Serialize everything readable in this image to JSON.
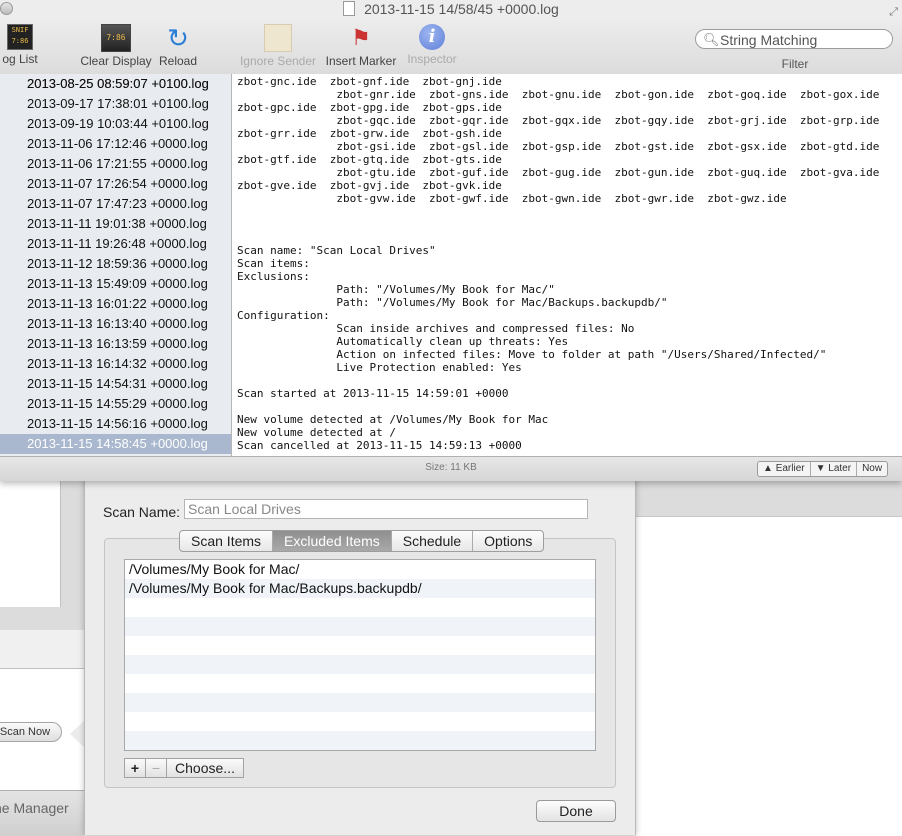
{
  "window": {
    "title": "2013-11-15 14/58/45 +0000.log"
  },
  "toolbar": {
    "log_list_label": "og List",
    "log_list_icon_text": "SNIF 7:86",
    "clear_display_label": "Clear Display",
    "clear_display_icon_text": "7:86",
    "reload_label": "Reload",
    "ignore_sender_label": "Ignore Sender",
    "insert_marker_label": "Insert Marker",
    "inspector_label": "Inspector",
    "filter_placeholder": "String Matching",
    "filter_label": "Filter"
  },
  "log_list": {
    "partial_top": "",
    "items": [
      "2013-08-25 08:59:07 +0100.log",
      "2013-09-17 17:38:01 +0100.log",
      "2013-09-19 10:03:44 +0100.log",
      "2013-11-06 17:12:46 +0000.log",
      "2013-11-06 17:21:55 +0000.log",
      "2013-11-07 17:26:54 +0000.log",
      "2013-11-07 17:47:23 +0000.log",
      "2013-11-11 19:01:38 +0000.log",
      "2013-11-11 19:26:48 +0000.log",
      "2013-11-12 18:59:36 +0000.log",
      "2013-11-13 15:49:09 +0000.log",
      "2013-11-13 16:01:22 +0000.log",
      "2013-11-13 16:13:40 +0000.log",
      "2013-11-13 16:13:59 +0000.log",
      "2013-11-13 16:14:32 +0000.log",
      "2013-11-15 14:54:31 +0000.log",
      "2013-11-15 14:55:29 +0000.log",
      "2013-11-15 14:56:16 +0000.log",
      "2013-11-15 14:58:45 +0000.log"
    ],
    "selected_index": 18
  },
  "log_text": [
    "zbot-gnc.ide  zbot-gnf.ide  zbot-gnj.ide",
    "               zbot-gnr.ide  zbot-gns.ide  zbot-gnu.ide  zbot-gon.ide  zbot-goq.ide  zbot-gox.ide",
    "zbot-gpc.ide  zbot-gpg.ide  zbot-gps.ide",
    "               zbot-gqc.ide  zbot-gqr.ide  zbot-gqx.ide  zbot-gqy.ide  zbot-grj.ide  zbot-grp.ide",
    "zbot-grr.ide  zbot-grw.ide  zbot-gsh.ide",
    "               zbot-gsi.ide  zbot-gsl.ide  zbot-gsp.ide  zbot-gst.ide  zbot-gsx.ide  zbot-gtd.ide",
    "zbot-gtf.ide  zbot-gtq.ide  zbot-gts.ide",
    "               zbot-gtu.ide  zbot-guf.ide  zbot-gug.ide  zbot-gun.ide  zbot-guq.ide  zbot-gva.ide",
    "zbot-gve.ide  zbot-gvj.ide  zbot-gvk.ide",
    "               zbot-gvw.ide  zbot-gwf.ide  zbot-gwn.ide  zbot-gwr.ide  zbot-gwz.ide",
    "",
    "",
    "",
    "Scan name: \"Scan Local Drives\"",
    "Scan items:",
    "Exclusions:",
    "               Path: \"/Volumes/My Book for Mac/\"",
    "               Path: \"/Volumes/My Book for Mac/Backups.backupdb/\"",
    "Configuration:",
    "               Scan inside archives and compressed files: No",
    "               Automatically clean up threats: Yes",
    "               Action on infected files: Move to folder at path \"/Users/Shared/Infected/\"",
    "               Live Protection enabled: Yes",
    "",
    "Scan started at 2013-11-15 14:59:01 +0000",
    "",
    "New volume detected at /Volumes/My Book for Mac",
    "New volume detected at /",
    "Scan cancelled at 2013-11-15 14:59:13 +0000"
  ],
  "status": {
    "size": "Size: 11 KB",
    "earlier": "Earlier",
    "later": "Later",
    "now": "Now"
  },
  "background": {
    "scan_now": "Scan Now",
    "bottom_label": "ne Manager"
  },
  "sheet": {
    "scan_name_label": "Scan Name:",
    "scan_name_value": "Scan Local Drives",
    "tabs": [
      "Scan Items",
      "Excluded Items",
      "Schedule",
      "Options"
    ],
    "active_tab": 1,
    "excluded_items": [
      "/Volumes/My Book for Mac/",
      "/Volumes/My Book for Mac/Backups.backupdb/",
      "",
      "",
      "",
      "",
      "",
      "",
      "",
      ""
    ],
    "add_label": "+",
    "remove_label": "−",
    "choose_label": "Choose...",
    "done_label": "Done"
  }
}
